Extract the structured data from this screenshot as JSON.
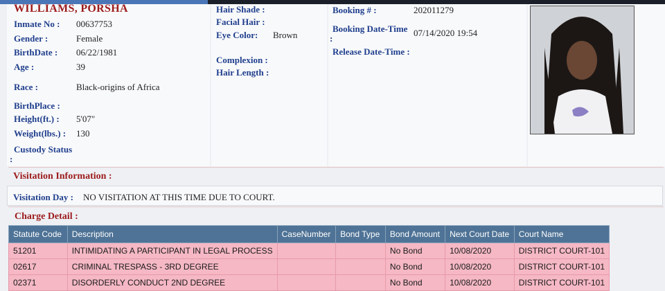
{
  "inmate": {
    "name": "WILLIAMS, PORSHA",
    "fields": {
      "inmate_no_label": "Inmate No :",
      "inmate_no": "00637753",
      "gender_label": "Gender :",
      "gender": "Female",
      "birthdate_label": "BirthDate :",
      "birthdate": "06/22/1981",
      "age_label": "Age :",
      "age": "39",
      "race_label": "Race :",
      "race": "Black-origins of Africa",
      "birthplace_label": "BirthPlace :",
      "height_label": "Height(ft.) :",
      "height": "5'07\"",
      "weight_label": "Weight(lbs.) :",
      "weight": "130",
      "custody_label": "Custody Status",
      "custody_colon": ":"
    },
    "appearance": {
      "hair_shade_label": "Hair Shade :",
      "facial_hair_label": "Facial Hair :",
      "eye_color_label": "Eye Color:",
      "eye_color": "Brown",
      "complexion_label": "Complexion :",
      "hair_length_label": "Hair Length :"
    },
    "booking": {
      "booking_no_label": "Booking # :",
      "booking_no": "202011279",
      "booking_dt_label": "Booking Date-Time",
      "booking_dt_colon": ":",
      "booking_dt": "07/14/2020 19:54",
      "release_label": "Release Date-Time :"
    }
  },
  "visitation": {
    "heading": "Visitation Information :",
    "day_label": "Visitation Day :",
    "day_value": "NO VISITATION AT THIS TIME DUE TO COURT."
  },
  "charges": {
    "heading": "Charge Detail :",
    "columns": [
      "Statute Code",
      "Description",
      "CaseNumber",
      "Bond Type",
      "Bond Amount",
      "Next Court Date",
      "Court Name"
    ],
    "rows": [
      [
        "51201",
        "INTIMIDATING A PARTICIPANT IN LEGAL PROCESS",
        "",
        "",
        "No Bond",
        "10/08/2020",
        "DISTRICT COURT-101"
      ],
      [
        "02617",
        "CRIMINAL TRESPASS - 3RD DEGREE",
        "",
        "",
        "No Bond",
        "10/08/2020",
        "DISTRICT COURT-101"
      ],
      [
        "02371",
        "DISORDERLY CONDUCT 2ND DEGREE",
        "",
        "",
        "No Bond",
        "10/08/2020",
        "DISTRICT COURT-101"
      ]
    ]
  },
  "colors": {
    "label": "#1f3e8c",
    "heading": "#9c1b1b",
    "table_header": "#4e7396",
    "row": "#f5b8c4"
  }
}
